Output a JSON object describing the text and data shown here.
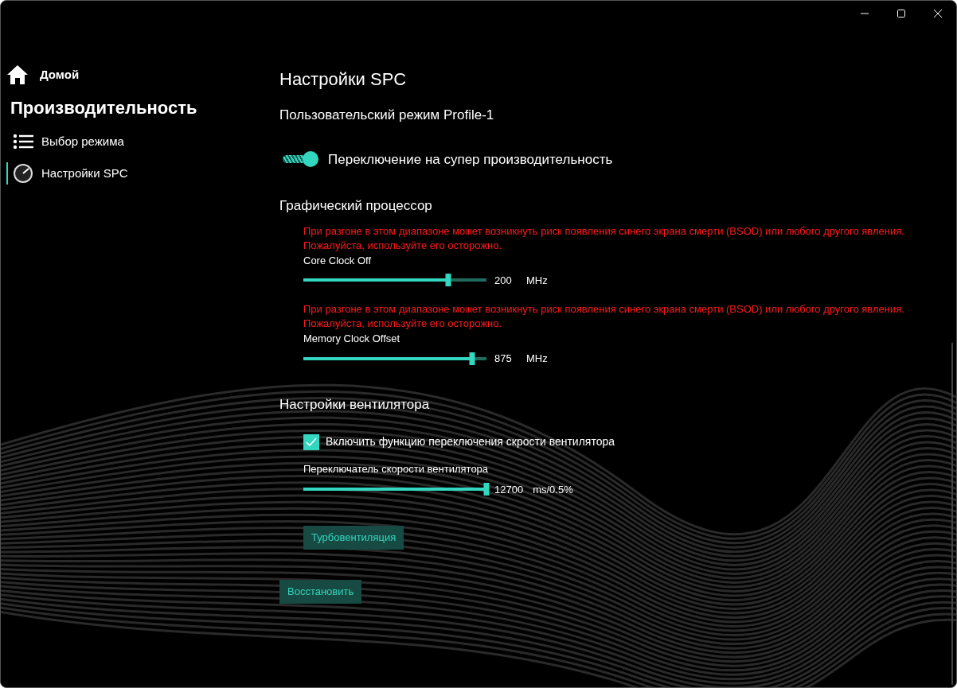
{
  "sidebar": {
    "home": "Домой",
    "section": "Производительность",
    "items": [
      {
        "label": "Выбор режима",
        "kind": "list",
        "selected": false
      },
      {
        "label": "Настройки SPC",
        "kind": "gauge",
        "selected": true
      }
    ]
  },
  "page": {
    "title": "Настройки SPC",
    "subtitle": "Пользовательский режим Profile-1",
    "super_mode": {
      "label": "Переключение на супер производительность",
      "on": true
    },
    "gpu": {
      "title": "Графический процессор",
      "sliders": [
        {
          "warning": "При разгоне в этом диапазоне может возникнуть риск появления синего экрана смерти (BSOD) или любого другого явления. Пожалуйста, используйте его осторожно.",
          "label": "Core Clock Off",
          "level": 0.79,
          "value": "200",
          "unit": "MHz"
        },
        {
          "warning": "При разгоне в этом диапазоне может возникнуть риск появления синего экрана смерти (BSOD) или любого другого явления. Пожалуйста, используйте его осторожно.",
          "label": "Memory Clock Offset",
          "level": 0.92,
          "value": "875",
          "unit": "MHz"
        }
      ]
    },
    "fan": {
      "title": "Настройки вентилятора",
      "checkbox": {
        "label": "Включить функцию переключения скрости вентилятора",
        "checked": true
      },
      "slider": {
        "label": "Переключатель скорости вентилятора",
        "level": 1.0,
        "value": "12700",
        "unit": "ms/0.5%"
      },
      "turbo_button": "Турбовентиляция"
    },
    "restore_button": "Восстановить"
  }
}
